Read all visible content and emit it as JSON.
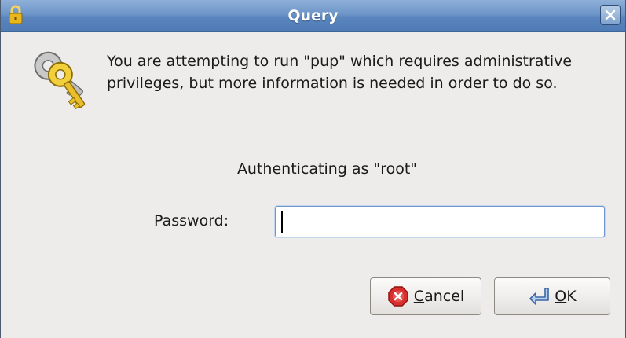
{
  "window": {
    "title": "Query",
    "title_icon": "lock-icon",
    "close_icon": "close-icon"
  },
  "dialog": {
    "icon": "keys-icon",
    "message": "You are attempting to run \"pup\" which requires administrative privileges, but more information is needed in order to do so.",
    "auth_text": "Authenticating as \"root\"",
    "password_label": "Password:",
    "password_value": ""
  },
  "buttons": {
    "cancel": {
      "mnemonic": "C",
      "rest": "ancel",
      "icon": "stop-icon"
    },
    "ok": {
      "mnemonic": "O",
      "rest": "K",
      "icon": "return-arrow-icon"
    }
  },
  "colors": {
    "titlebar": "#5a85be",
    "dialog_bg": "#edeceb",
    "input_focus_border": "#6f97cf"
  }
}
